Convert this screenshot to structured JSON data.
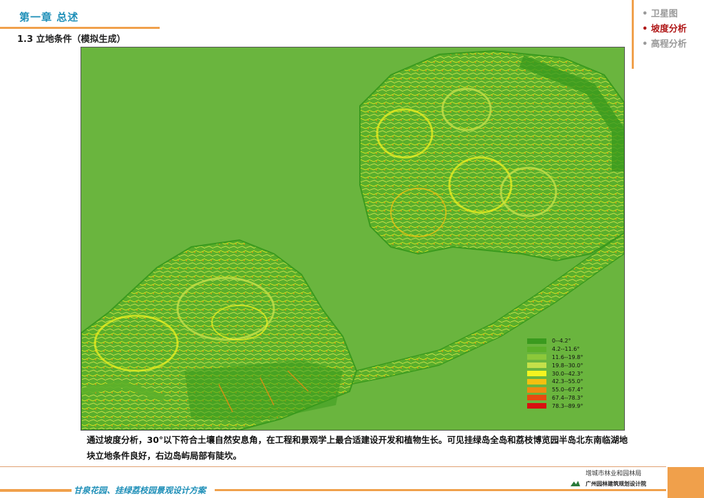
{
  "header": {
    "chapter": "第一章   总述",
    "section": "1.3 立地条件（模拟生成）"
  },
  "nav": {
    "items": [
      {
        "label": "• 卫星图",
        "active": false
      },
      {
        "label": "• 坡度分析",
        "active": true
      },
      {
        "label": "• 高程分析",
        "active": false
      }
    ]
  },
  "legend": {
    "items": [
      {
        "label": "0--4.2°",
        "color": "#3a9a1e"
      },
      {
        "label": "4.2--11.6°",
        "color": "#5cb02a"
      },
      {
        "label": "11.6--19.8°",
        "color": "#8cc83a"
      },
      {
        "label": "19.8--30.0°",
        "color": "#c4e04a"
      },
      {
        "label": "30.0--42.3°",
        "color": "#f4f420"
      },
      {
        "label": "42.3--55.0°",
        "color": "#f4c010"
      },
      {
        "label": "55.0--67.4°",
        "color": "#f08a10"
      },
      {
        "label": "67.4--78.3°",
        "color": "#e84a10"
      },
      {
        "label": "78.3--89.9°",
        "color": "#d81010"
      }
    ]
  },
  "caption": "通过坡度分析，30°以下符合土壤自然安息角，在工程和景观学上最合适建设开发和植物生长。可见挂绿岛全岛和荔枝博览园半岛北东南临湖地块立地条件良好，右边岛屿局部有陡坎。",
  "footer": {
    "title": "甘泉花园、挂绿荔枝园景观设计方案",
    "org1": "增城市林业和园林局",
    "org2": "广州园林建筑规划设计院"
  }
}
